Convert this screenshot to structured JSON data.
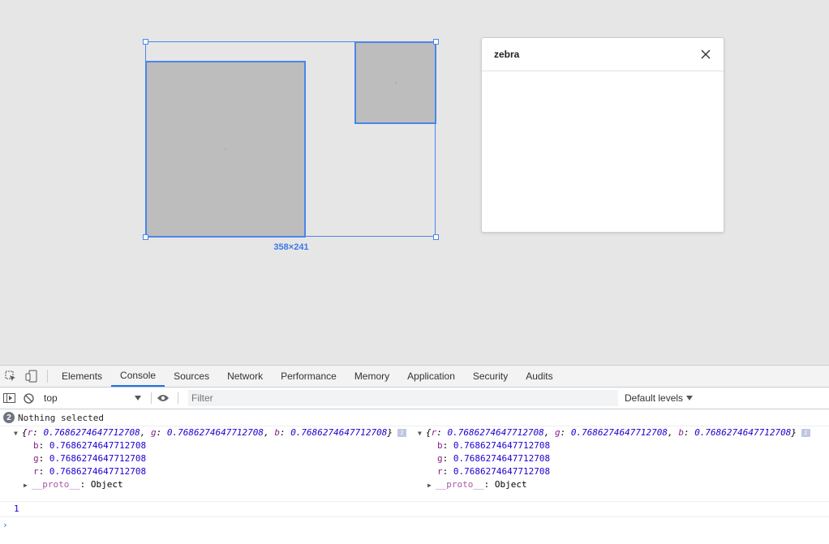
{
  "canvas": {
    "dimension_label": "358×241",
    "accent": "#4a86e8",
    "shape_fill": "#bdbdbd"
  },
  "panel": {
    "title": "zebra",
    "close_icon": "close-icon"
  },
  "devtools": {
    "tabs": [
      "Elements",
      "Console",
      "Sources",
      "Network",
      "Performance",
      "Memory",
      "Application",
      "Security",
      "Audits"
    ],
    "active_tab": "Console",
    "context": "top",
    "filter_placeholder": "Filter",
    "levels": "Default levels",
    "message_count": "2",
    "nothing_selected": "Nothing selected",
    "objects": [
      {
        "summary_r": "0.7686274647712708",
        "summary_g": "0.7686274647712708",
        "summary_b": "0.7686274647712708",
        "b": "0.7686274647712708",
        "g": "0.7686274647712708",
        "r": "0.7686274647712708",
        "proto_label": "__proto__",
        "proto_value": "Object"
      },
      {
        "summary_r": "0.7686274647712708",
        "summary_g": "0.7686274647712708",
        "summary_b": "0.7686274647712708",
        "b": "0.7686274647712708",
        "g": "0.7686274647712708",
        "r": "0.7686274647712708",
        "proto_label": "__proto__",
        "proto_value": "Object"
      }
    ],
    "result": "1",
    "prompt": "›"
  }
}
